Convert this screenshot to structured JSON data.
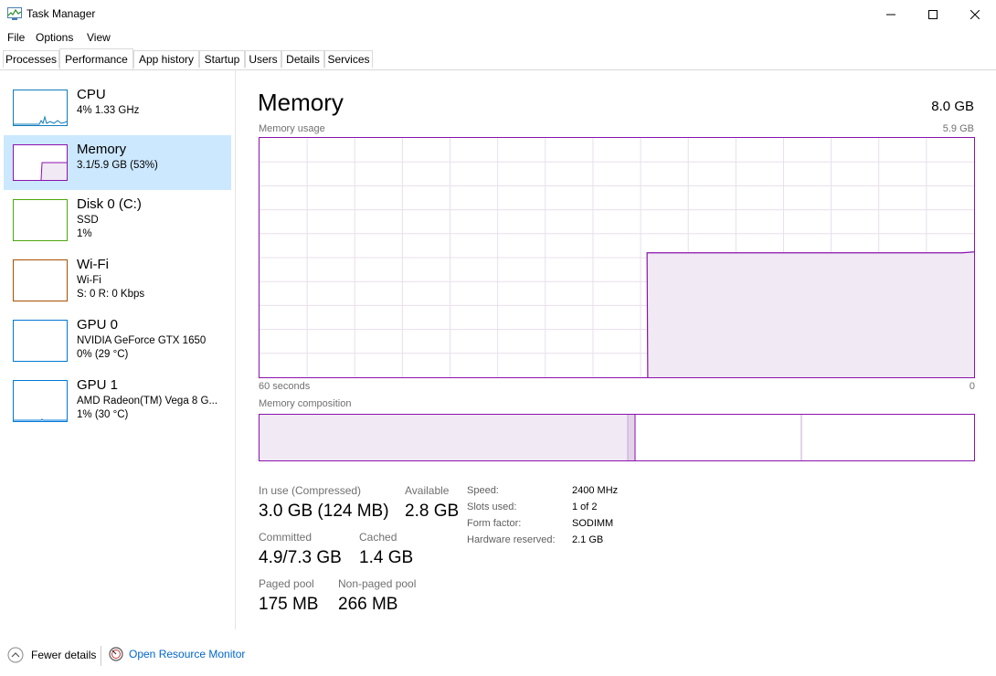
{
  "window": {
    "title": "Task Manager"
  },
  "menu": [
    "File",
    "Options",
    "View"
  ],
  "tabs": [
    "Processes",
    "Performance",
    "App history",
    "Startup",
    "Users",
    "Details",
    "Services"
  ],
  "active_tab": "Performance",
  "colors": {
    "memory": "#8b12ae",
    "cpu": "#117dbb",
    "disk": "#4da60c",
    "wifi": "#a74f01",
    "gpu": "#0078d7",
    "selected_bg": "#cce8ff",
    "link": "#0066cc"
  },
  "sidebar": [
    {
      "title": "CPU",
      "lines": [
        "4%  1.33 GHz"
      ]
    },
    {
      "title": "Memory",
      "lines": [
        "3.1/5.9 GB (53%)"
      ]
    },
    {
      "title": "Disk 0 (C:)",
      "lines": [
        "SSD",
        "1%"
      ]
    },
    {
      "title": "Wi-Fi",
      "lines": [
        "Wi-Fi",
        "S: 0 R: 0 Kbps"
      ]
    },
    {
      "title": "GPU 0",
      "lines": [
        "NVIDIA GeForce GTX 1650",
        "0%  (29 °C)"
      ]
    },
    {
      "title": "GPU 1",
      "lines": [
        "AMD Radeon(TM) Vega 8 G...",
        "1%  (30 °C)"
      ]
    }
  ],
  "main": {
    "title": "Memory",
    "total": "8.0 GB",
    "usage_label": "Memory usage",
    "usage_max": "5.9 GB",
    "x_left": "60 seconds",
    "x_right": "0",
    "composition_label": "Memory composition",
    "usage_history_fraction": [
      0,
      0,
      0,
      0,
      0,
      0,
      0,
      0,
      0,
      0,
      0,
      0,
      0,
      0,
      0,
      0,
      0,
      0,
      0,
      0,
      0,
      0,
      0,
      0,
      0,
      0,
      0,
      0,
      0,
      0,
      0,
      0,
      0.52,
      0.52,
      0.52,
      0.52,
      0.52,
      0.52,
      0.52,
      0.52,
      0.52,
      0.52,
      0.52,
      0.52,
      0.52,
      0.52,
      0.52,
      0.52,
      0.52,
      0.52,
      0.52,
      0.52,
      0.52,
      0.52,
      0.52,
      0.52,
      0.52,
      0.52,
      0.52,
      0.52
    ]
  },
  "stats": {
    "in_use_label": "In use (Compressed)",
    "in_use_value": "3.0 GB (124 MB)",
    "available_label": "Available",
    "available_value": "2.8 GB",
    "committed_label": "Committed",
    "committed_value": "4.9/7.3 GB",
    "cached_label": "Cached",
    "cached_value": "1.4 GB",
    "paged_label": "Paged pool",
    "paged_value": "175 MB",
    "nonpaged_label": "Non-paged pool",
    "nonpaged_value": "266 MB"
  },
  "details": [
    {
      "key": "Speed:",
      "value": "2400 MHz"
    },
    {
      "key": "Slots used:",
      "value": "1 of 2"
    },
    {
      "key": "Form factor:",
      "value": "SODIMM"
    },
    {
      "key": "Hardware reserved:",
      "value": "2.1 GB"
    }
  ],
  "footer": {
    "fewer_details": "Fewer details",
    "open_resource_monitor": "Open Resource Monitor"
  }
}
